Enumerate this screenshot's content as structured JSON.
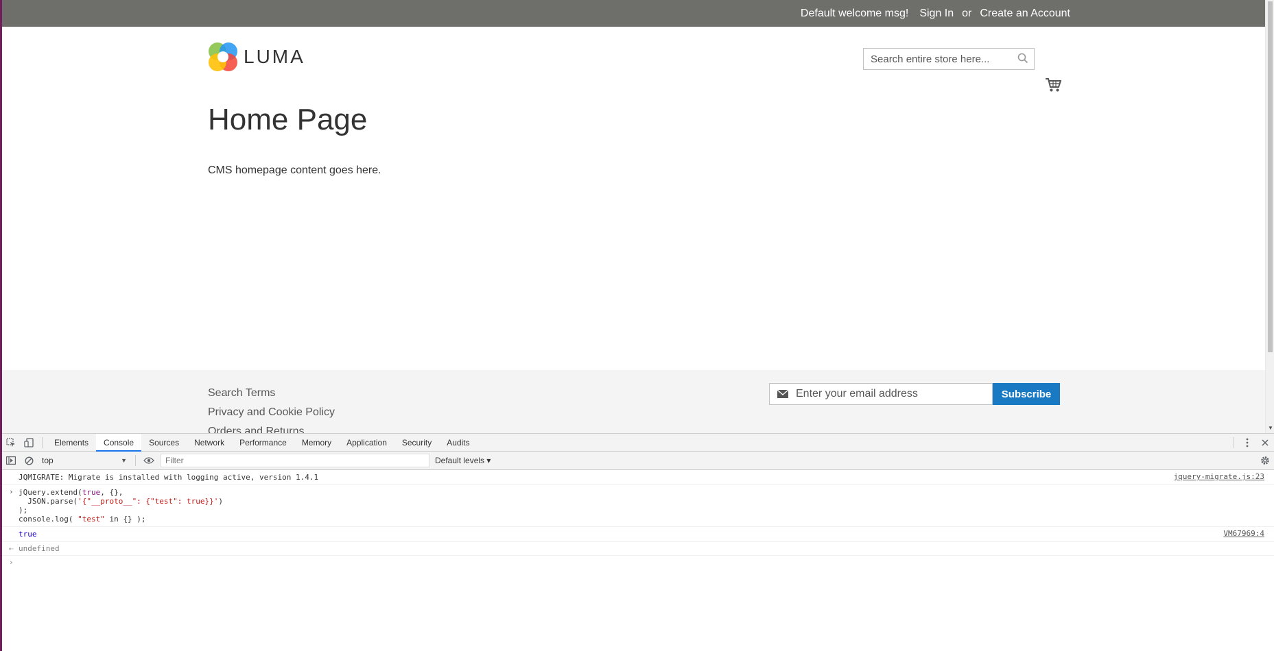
{
  "topbar": {
    "welcome": "Default welcome msg!",
    "sign_in": "Sign In",
    "or": "or",
    "create_account": "Create an Account"
  },
  "header": {
    "logo_text": "LUMA",
    "search_placeholder": "Search entire store here..."
  },
  "main": {
    "title": "Home Page",
    "content": "CMS homepage content goes here."
  },
  "footer": {
    "links": [
      "Search Terms",
      "Privacy and Cookie Policy",
      "Orders and Returns"
    ],
    "newsletter_placeholder": "Enter your email address",
    "subscribe_label": "Subscribe"
  },
  "devtools": {
    "tabs": [
      "Elements",
      "Console",
      "Sources",
      "Network",
      "Performance",
      "Memory",
      "Application",
      "Security",
      "Audits"
    ],
    "active_tab": "Console",
    "context": "top",
    "filter_placeholder": "Filter",
    "levels": "Default levels ▾",
    "messages": {
      "migrate": "JQMIGRATE: Migrate is installed with logging active, version 1.4.1",
      "migrate_src": "jquery-migrate.js:23",
      "input_line1_a": "jQuery.extend(",
      "input_line1_b": "true",
      "input_line1_c": ", {},",
      "input_line2_a": "  JSON.parse(",
      "input_line2_b": "'{\"__proto__\": {\"test\": true}}'",
      "input_line2_c": ")",
      "input_line3": ");",
      "input_line4_a": "console.log( ",
      "input_line4_b": "\"test\"",
      "input_line4_c": " in {} );",
      "log_result": "true",
      "log_src": "VM67969:4",
      "return_value": "undefined"
    }
  }
}
